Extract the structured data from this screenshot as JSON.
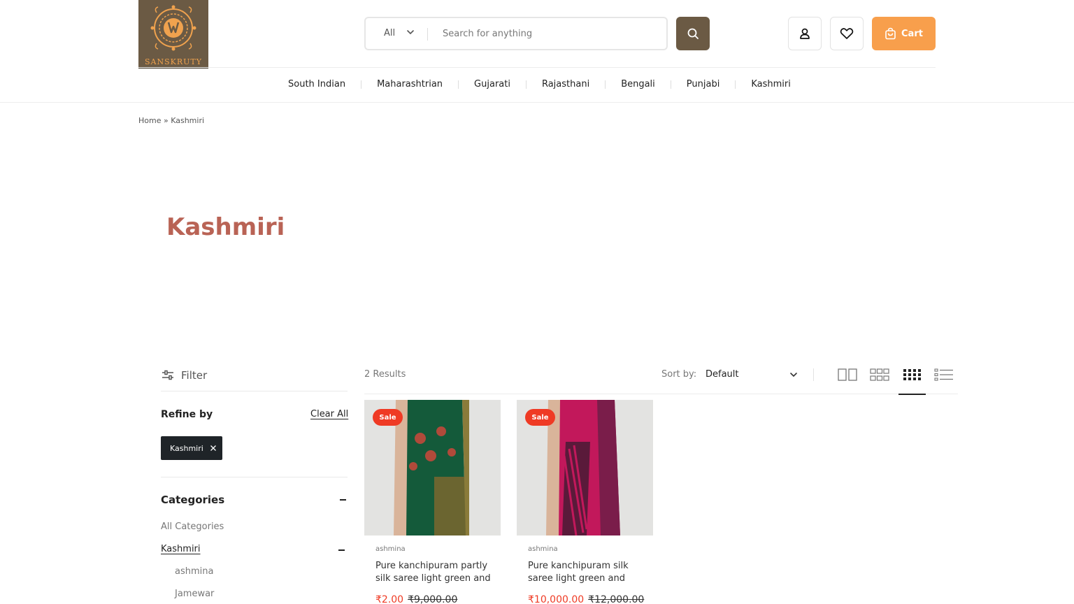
{
  "brand": {
    "name": "SANSKRUTY",
    "bg_color": "#6b5a44",
    "accent_color": "#f0a24e"
  },
  "search": {
    "category": "All",
    "placeholder": "Search for anything"
  },
  "header": {
    "cart_label": "Cart",
    "cart_color": "#f89f4c",
    "icons": [
      "account-icon",
      "wishlist-icon",
      "cart-icon"
    ]
  },
  "nav": {
    "items": [
      "South Indian",
      "Maharashtrian",
      "Gujarati",
      "Rajasthani",
      "Bengali",
      "Punjabi",
      "Kashmiri"
    ]
  },
  "breadcrumb": {
    "home": "Home",
    "sep": " » ",
    "current": "Kashmiri"
  },
  "page_title": "Kashmiri",
  "title_color": "#b96355",
  "sidebar": {
    "filter_label": "Filter",
    "refine_label": "Refine by",
    "clear_all": "Clear All",
    "active_filter": "Kashmiri",
    "categories_title": "Categories",
    "category_links": [
      "All Categories",
      "Kashmiri",
      "ashmina",
      "Jamewar"
    ]
  },
  "toolbar": {
    "results": "2 Results",
    "sort_label": "Sort by:",
    "sort_value": "Default",
    "active_view": "grid-4-columns"
  },
  "products": [
    {
      "badge": "Sale",
      "vendor": "ashmina",
      "name": "Pure kanchipuram partly silk saree light green and",
      "price": "₹2.00",
      "compare_price": "₹9,000.00"
    },
    {
      "badge": "Sale",
      "vendor": "ashmina",
      "name": "Pure kanchipuram silk saree light green and",
      "price": "₹10,000.00",
      "compare_price": "₹12,000.00"
    }
  ]
}
